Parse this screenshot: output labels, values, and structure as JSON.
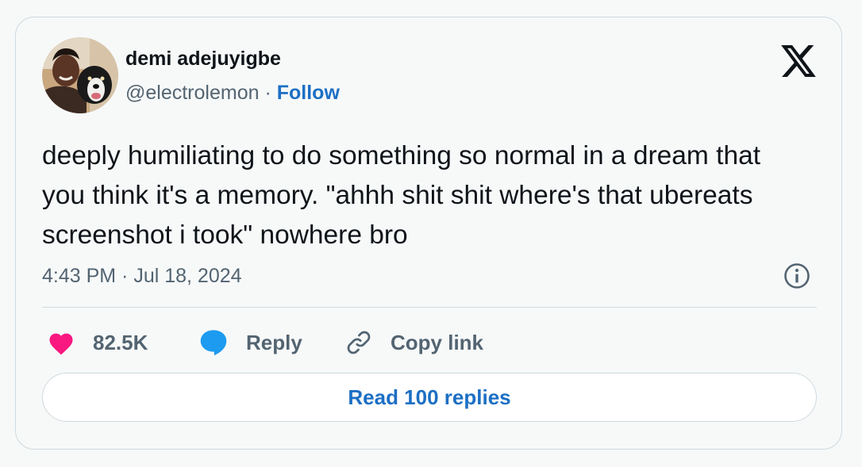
{
  "author": {
    "display_name": "demi adejuyigbe",
    "handle": "@electrolemon",
    "separator": " · ",
    "follow_label": "Follow"
  },
  "tweet": {
    "text": "deeply humiliating to do something so normal in a dream that you think it's a memory. \"ahhh shit shit where's that ubereats screenshot i took\" nowhere bro",
    "timestamp": "4:43 PM · Jul 18, 2024"
  },
  "actions": {
    "like_count": "82.5K",
    "reply_label": "Reply",
    "copy_link_label": "Copy link"
  },
  "read_replies_label": "Read 100 replies",
  "icons": {
    "brand": "x-logo-icon",
    "info": "info-icon",
    "like": "heart-icon",
    "reply": "speech-bubble-icon",
    "copy": "link-icon"
  },
  "colors": {
    "accent": "#1d6fc4",
    "like": "#f91880",
    "reply": "#1d9bf0",
    "muted": "#536471",
    "text": "#0f1419",
    "border": "#cfd9de"
  }
}
